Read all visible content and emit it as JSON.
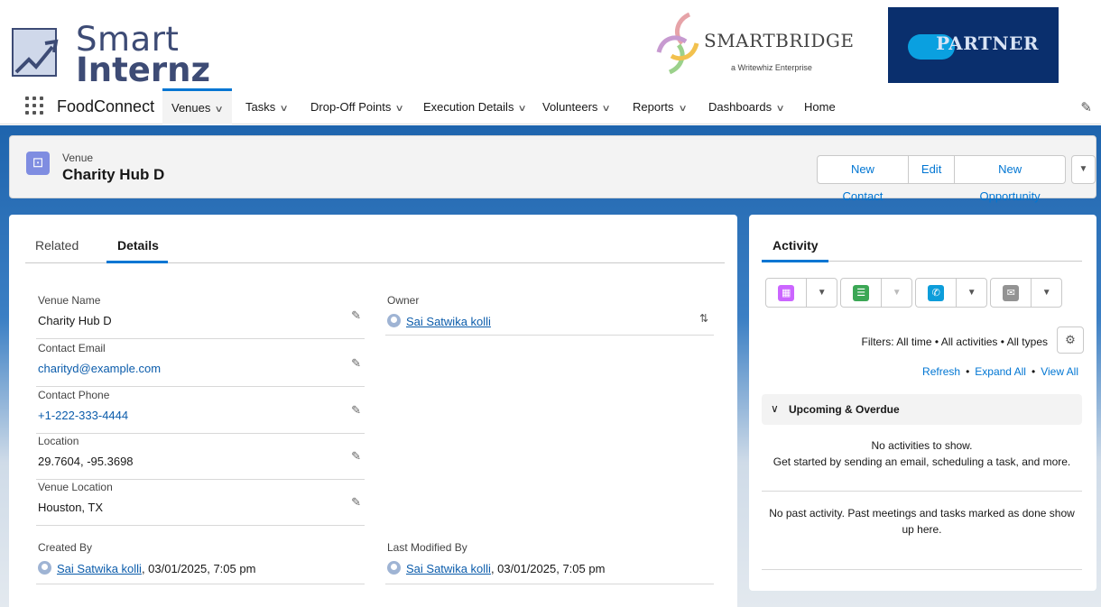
{
  "logos": {
    "smartinternz_line1": "Smart",
    "smartinternz_line2": "Internz",
    "smartbridge_title": "SMARTBRIDGE",
    "smartbridge_tagline": "a Writewhiz Enterprise",
    "partner_text": "PARTNER"
  },
  "nav": {
    "app_name": "FoodConnect",
    "items": [
      {
        "label": "Venues",
        "has_menu": true
      },
      {
        "label": "Tasks",
        "has_menu": true
      },
      {
        "label": "Drop-Off Points",
        "has_menu": true
      },
      {
        "label": "Execution Details",
        "has_menu": true
      },
      {
        "label": "Volunteers",
        "has_menu": true
      },
      {
        "label": "Reports",
        "has_menu": true
      },
      {
        "label": "Dashboards",
        "has_menu": true
      },
      {
        "label": "Home",
        "has_menu": false
      }
    ],
    "active_index": 0
  },
  "header": {
    "record_type": "Venue",
    "record_title": "Charity Hub D",
    "buttons": {
      "new_contact": "New Contact",
      "edit": "Edit",
      "new_opportunity": "New Opportunity"
    }
  },
  "details": {
    "tabs": {
      "related": "Related",
      "details": "Details"
    },
    "fields": {
      "venue_name": {
        "label": "Venue Name",
        "value": "Charity Hub D"
      },
      "contact_email": {
        "label": "Contact Email",
        "value": "charityd@example.com"
      },
      "contact_phone": {
        "label": "Contact Phone",
        "value": "+1-222-333-4444"
      },
      "location": {
        "label": "Location",
        "value": "29.7604, -95.3698"
      },
      "venue_location": {
        "label": "Venue Location",
        "value": "Houston, TX"
      },
      "owner": {
        "label": "Owner",
        "value": "Sai Satwika kolli"
      },
      "created_by": {
        "label": "Created By",
        "user": "Sai Satwika kolli",
        "timestamp": ", 03/01/2025, 7:05 pm"
      },
      "last_modified_by": {
        "label": "Last Modified By",
        "user": "Sai Satwika kolli",
        "timestamp": ", 03/01/2025, 7:05 pm"
      }
    }
  },
  "activity": {
    "title": "Activity",
    "filters": "Filters: All time • All activities • All types",
    "links": {
      "refresh": "Refresh",
      "expand_all": "Expand All",
      "view_all": "View All"
    },
    "upcoming_label": "Upcoming & Overdue",
    "no_activities_line1": "No activities to show.",
    "no_activities_line2": "Get started by sending an email, scheduling a task, and more.",
    "no_past": "No past activity. Past meetings and tasks marked as done show up here."
  },
  "colors": {
    "brand_blue": "#0176d3",
    "event_purple": "#cb65ff",
    "task_green": "#3ba755",
    "call_teal": "#0d9dda",
    "email_gray": "#939393",
    "venue_icon": "#7f8de1"
  }
}
